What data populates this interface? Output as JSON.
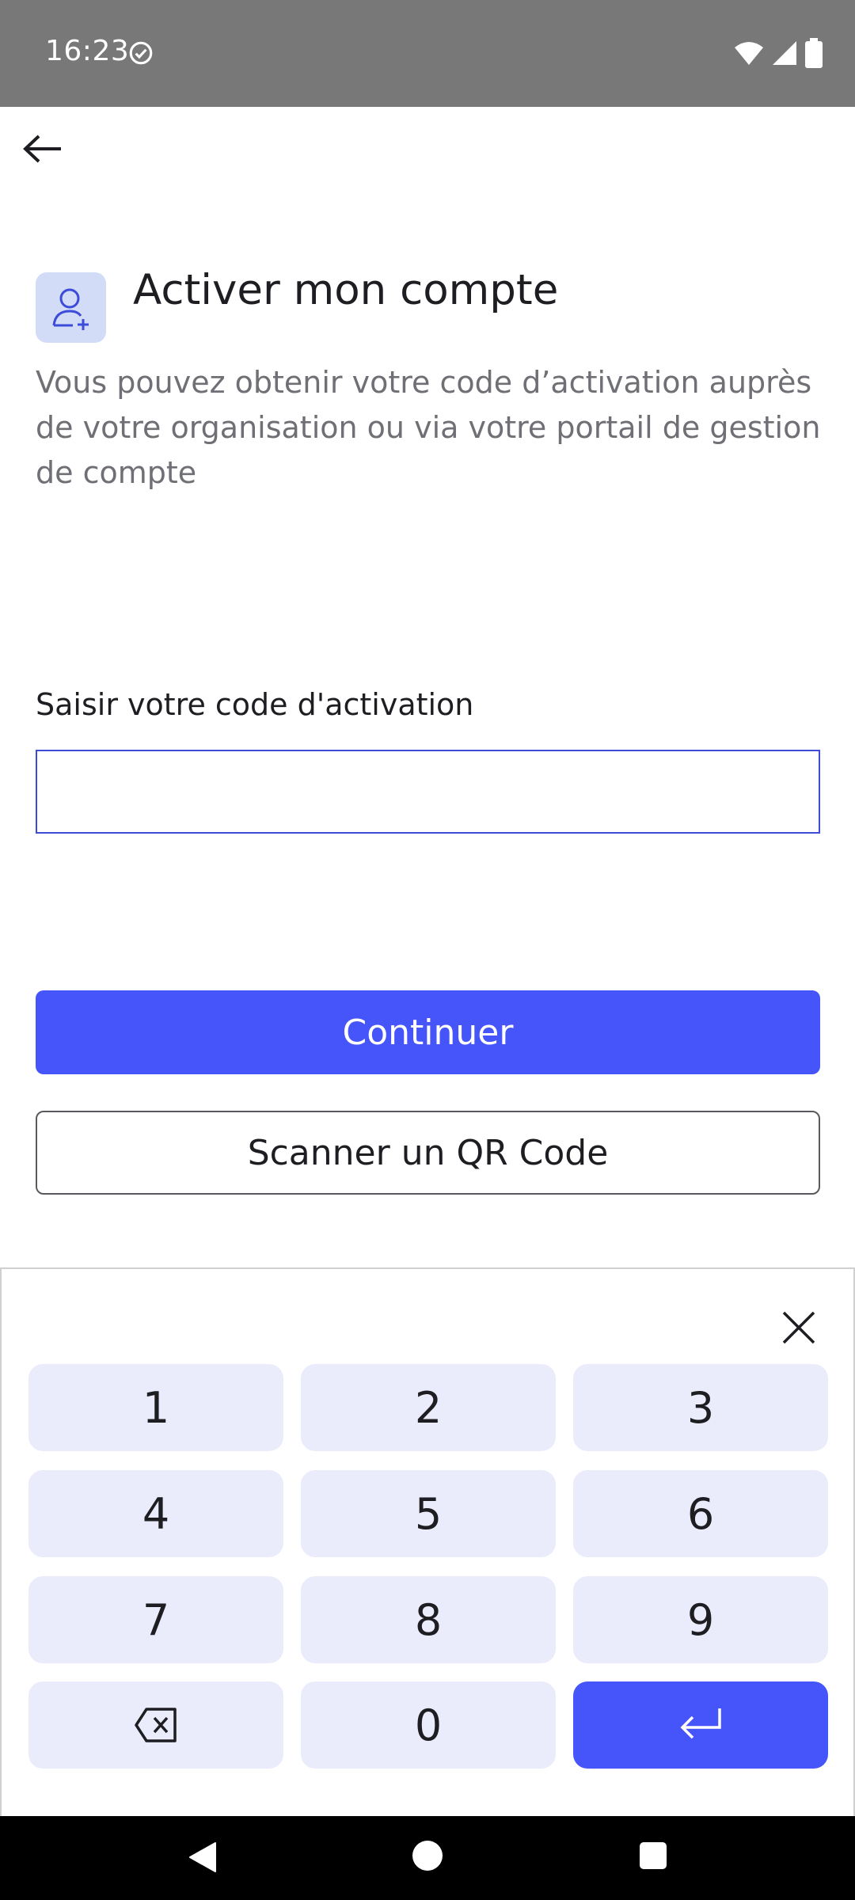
{
  "status_bar": {
    "time": "16:23"
  },
  "header": {
    "title": "Activer mon compte",
    "subtitle": "Vous pouvez obtenir votre code d’activation auprès de votre organisation ou via votre portail de gestion de compte"
  },
  "form": {
    "label": "Saisir votre code d'activation",
    "value": "",
    "placeholder": ""
  },
  "buttons": {
    "continue": "Continuer",
    "scan": "Scanner un QR Code"
  },
  "keypad": {
    "keys": [
      "1",
      "2",
      "3",
      "4",
      "5",
      "6",
      "7",
      "8",
      "9",
      "0"
    ],
    "icons": {
      "delete": "backspace-icon",
      "enter": "enter-icon",
      "close": "close-icon"
    }
  },
  "colors": {
    "accent": "#4655fa",
    "key_background": "#eaecfc",
    "icon_background": "#d3dcf7",
    "status_bar": "#787878"
  }
}
